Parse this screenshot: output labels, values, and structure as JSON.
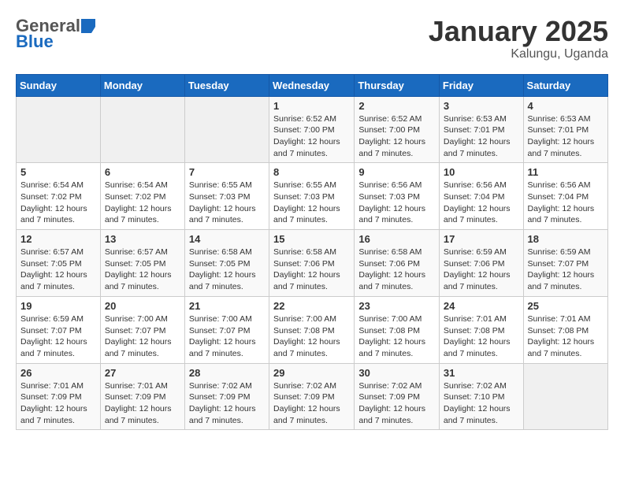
{
  "logo": {
    "general": "General",
    "blue": "Blue"
  },
  "title": "January 2025",
  "subtitle": "Kalungu, Uganda",
  "days_header": [
    "Sunday",
    "Monday",
    "Tuesday",
    "Wednesday",
    "Thursday",
    "Friday",
    "Saturday"
  ],
  "weeks": [
    [
      {
        "num": "",
        "info": ""
      },
      {
        "num": "",
        "info": ""
      },
      {
        "num": "",
        "info": ""
      },
      {
        "num": "1",
        "info": "Sunrise: 6:52 AM\nSunset: 7:00 PM\nDaylight: 12 hours\nand 7 minutes."
      },
      {
        "num": "2",
        "info": "Sunrise: 6:52 AM\nSunset: 7:00 PM\nDaylight: 12 hours\nand 7 minutes."
      },
      {
        "num": "3",
        "info": "Sunrise: 6:53 AM\nSunset: 7:01 PM\nDaylight: 12 hours\nand 7 minutes."
      },
      {
        "num": "4",
        "info": "Sunrise: 6:53 AM\nSunset: 7:01 PM\nDaylight: 12 hours\nand 7 minutes."
      }
    ],
    [
      {
        "num": "5",
        "info": "Sunrise: 6:54 AM\nSunset: 7:02 PM\nDaylight: 12 hours\nand 7 minutes."
      },
      {
        "num": "6",
        "info": "Sunrise: 6:54 AM\nSunset: 7:02 PM\nDaylight: 12 hours\nand 7 minutes."
      },
      {
        "num": "7",
        "info": "Sunrise: 6:55 AM\nSunset: 7:03 PM\nDaylight: 12 hours\nand 7 minutes."
      },
      {
        "num": "8",
        "info": "Sunrise: 6:55 AM\nSunset: 7:03 PM\nDaylight: 12 hours\nand 7 minutes."
      },
      {
        "num": "9",
        "info": "Sunrise: 6:56 AM\nSunset: 7:03 PM\nDaylight: 12 hours\nand 7 minutes."
      },
      {
        "num": "10",
        "info": "Sunrise: 6:56 AM\nSunset: 7:04 PM\nDaylight: 12 hours\nand 7 minutes."
      },
      {
        "num": "11",
        "info": "Sunrise: 6:56 AM\nSunset: 7:04 PM\nDaylight: 12 hours\nand 7 minutes."
      }
    ],
    [
      {
        "num": "12",
        "info": "Sunrise: 6:57 AM\nSunset: 7:05 PM\nDaylight: 12 hours\nand 7 minutes."
      },
      {
        "num": "13",
        "info": "Sunrise: 6:57 AM\nSunset: 7:05 PM\nDaylight: 12 hours\nand 7 minutes."
      },
      {
        "num": "14",
        "info": "Sunrise: 6:58 AM\nSunset: 7:05 PM\nDaylight: 12 hours\nand 7 minutes."
      },
      {
        "num": "15",
        "info": "Sunrise: 6:58 AM\nSunset: 7:06 PM\nDaylight: 12 hours\nand 7 minutes."
      },
      {
        "num": "16",
        "info": "Sunrise: 6:58 AM\nSunset: 7:06 PM\nDaylight: 12 hours\nand 7 minutes."
      },
      {
        "num": "17",
        "info": "Sunrise: 6:59 AM\nSunset: 7:06 PM\nDaylight: 12 hours\nand 7 minutes."
      },
      {
        "num": "18",
        "info": "Sunrise: 6:59 AM\nSunset: 7:07 PM\nDaylight: 12 hours\nand 7 minutes."
      }
    ],
    [
      {
        "num": "19",
        "info": "Sunrise: 6:59 AM\nSunset: 7:07 PM\nDaylight: 12 hours\nand 7 minutes."
      },
      {
        "num": "20",
        "info": "Sunrise: 7:00 AM\nSunset: 7:07 PM\nDaylight: 12 hours\nand 7 minutes."
      },
      {
        "num": "21",
        "info": "Sunrise: 7:00 AM\nSunset: 7:07 PM\nDaylight: 12 hours\nand 7 minutes."
      },
      {
        "num": "22",
        "info": "Sunrise: 7:00 AM\nSunset: 7:08 PM\nDaylight: 12 hours\nand 7 minutes."
      },
      {
        "num": "23",
        "info": "Sunrise: 7:00 AM\nSunset: 7:08 PM\nDaylight: 12 hours\nand 7 minutes."
      },
      {
        "num": "24",
        "info": "Sunrise: 7:01 AM\nSunset: 7:08 PM\nDaylight: 12 hours\nand 7 minutes."
      },
      {
        "num": "25",
        "info": "Sunrise: 7:01 AM\nSunset: 7:08 PM\nDaylight: 12 hours\nand 7 minutes."
      }
    ],
    [
      {
        "num": "26",
        "info": "Sunrise: 7:01 AM\nSunset: 7:09 PM\nDaylight: 12 hours\nand 7 minutes."
      },
      {
        "num": "27",
        "info": "Sunrise: 7:01 AM\nSunset: 7:09 PM\nDaylight: 12 hours\nand 7 minutes."
      },
      {
        "num": "28",
        "info": "Sunrise: 7:02 AM\nSunset: 7:09 PM\nDaylight: 12 hours\nand 7 minutes."
      },
      {
        "num": "29",
        "info": "Sunrise: 7:02 AM\nSunset: 7:09 PM\nDaylight: 12 hours\nand 7 minutes."
      },
      {
        "num": "30",
        "info": "Sunrise: 7:02 AM\nSunset: 7:09 PM\nDaylight: 12 hours\nand 7 minutes."
      },
      {
        "num": "31",
        "info": "Sunrise: 7:02 AM\nSunset: 7:10 PM\nDaylight: 12 hours\nand 7 minutes."
      },
      {
        "num": "",
        "info": ""
      }
    ]
  ]
}
